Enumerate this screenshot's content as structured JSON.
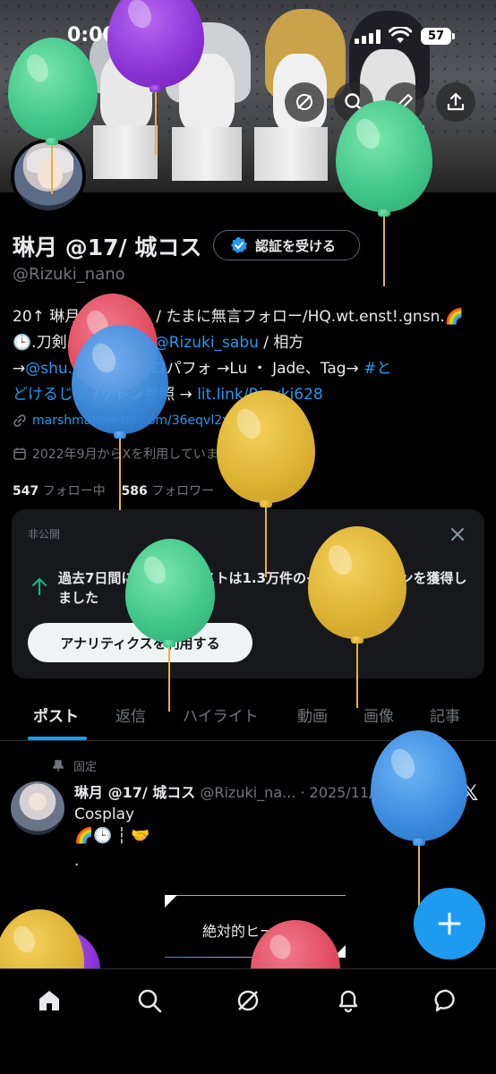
{
  "status_bar": {
    "time": "0:00",
    "battery": "57"
  },
  "profile": {
    "display_name": "琳月 @17/ 城コス",
    "verify_button": "認証を受ける",
    "handle": "@Rizuki_nano",
    "bio_lines": [
      {
        "text": "20↑ 琳月（りづき）/ たまに無言フォロー/HQ.wt.enst!.gnsn.🌈",
        "link": ""
      },
      {
        "text": "🕒.刀剣...住み/🗝 →",
        "link": "@Rizuki_sabu",
        "after": " / 相方"
      },
      {
        "text": "→",
        "link": "@shu...0030",
        "after": " / ソロパフォ →Lu ・ Jade、Tag→ ",
        "link2": "#と"
      },
      {
        "text": "",
        "link": "どけるじぇ",
        "after": " /リトン参照 → ",
        "link2": "lit.link/Rizuki628"
      }
    ],
    "website": "marshmallow-qa.com/36eqvl2xjy0z9f...",
    "joined": "2022年9月からXを利用しています",
    "following_count": "547",
    "following_label": "フォロー中",
    "followers_count": "586",
    "followers_label": "フォロワー"
  },
  "private_card": {
    "label": "非公開",
    "text": "過去7日間にあなたのポストは1.3万件のインプレッションを獲得しました",
    "button": "アナリティクスを利用する"
  },
  "tabs": [
    "ポスト",
    "返信",
    "ハイライト",
    "動画",
    "画像",
    "記事"
  ],
  "pinned_post": {
    "pinned_label": "固定",
    "author": "琳月 @17/ 城コス",
    "handle_date": "@Rizuki_na... · 2025/11/12",
    "body": "Cosplay",
    "emoji_line": "🌈🕒 ┆ 🤝",
    "dot": ".",
    "framed_text": "絶対的ヒーロー"
  },
  "icons": {
    "back": "back-arrow-icon",
    "grok": "grok-icon",
    "search": "search-icon",
    "edit": "pencil-icon",
    "share": "share-icon",
    "verified": "verified-badge-icon",
    "link": "link-icon",
    "calendar": "calendar-icon",
    "close": "close-icon",
    "arrow_up": "arrow-up-icon",
    "pin": "pin-icon",
    "x_logo": "x-logo-icon",
    "compose": "plus-icon",
    "home": "home-icon",
    "explore": "search-icon",
    "grok_nav": "grok-icon",
    "notifications": "bell-icon",
    "messages": "message-icon"
  },
  "colors": {
    "accent": "#1d9bf0",
    "background": "#000000",
    "muted": "#71767b"
  }
}
